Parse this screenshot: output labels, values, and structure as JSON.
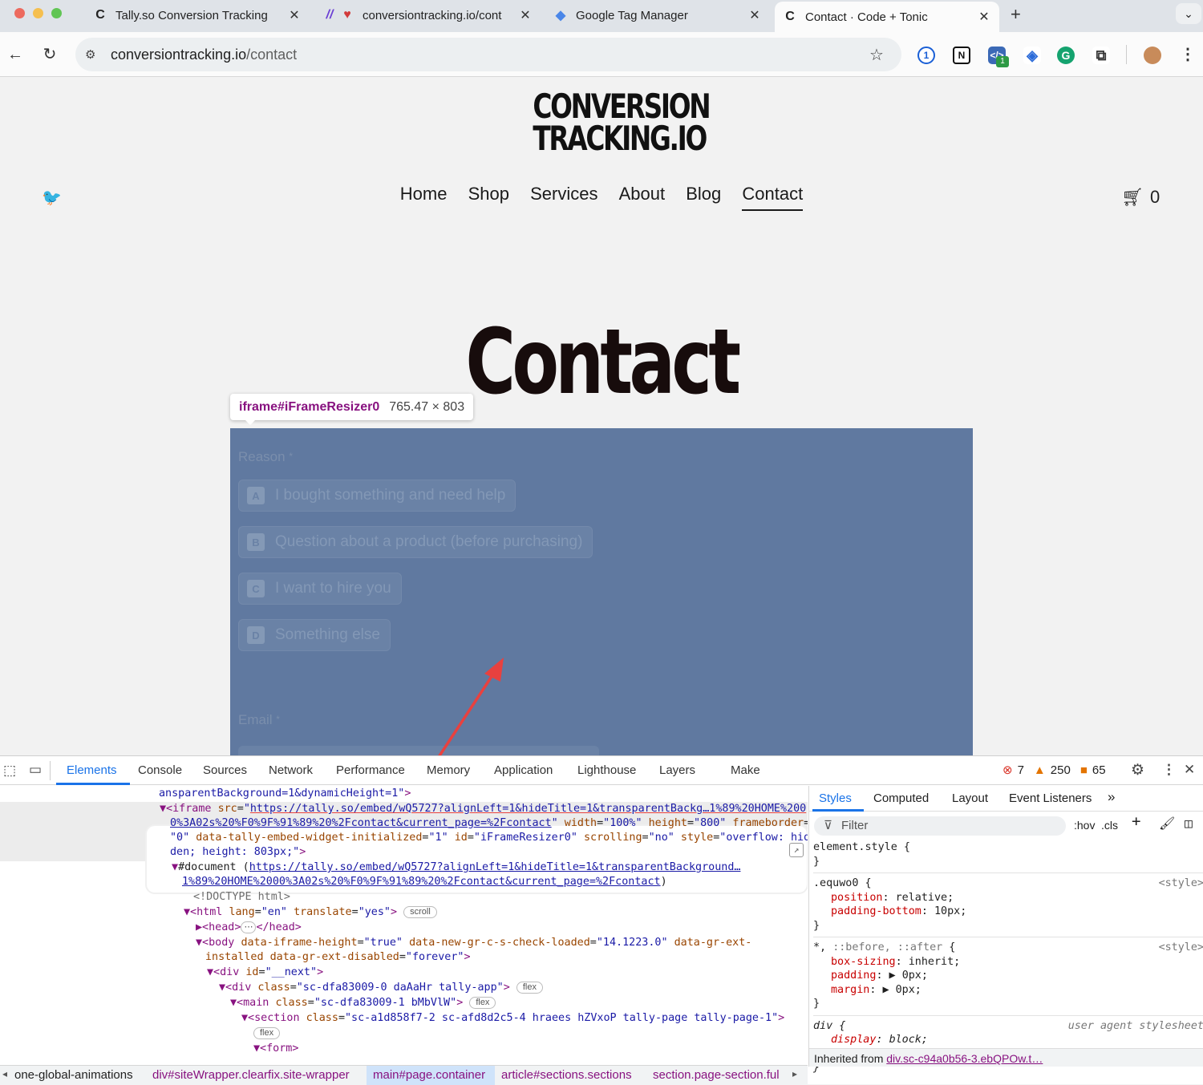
{
  "browser": {
    "tabs": [
      {
        "title": "Tally.so Conversion Tracking",
        "icon": "C"
      },
      {
        "title": "conversiontracking.io/cont",
        "icon": "M"
      },
      {
        "title": "Google Tag Manager",
        "icon": "gtm"
      },
      {
        "title": "Contact · Code + Tonic",
        "icon": "C"
      }
    ],
    "url_host": "conversiontracking.io",
    "url_path": "/contact",
    "ext_badge": "1"
  },
  "site": {
    "logo_line1": "CONVERSION",
    "logo_line2": "TRACKING.IO",
    "nav": [
      "Home",
      "Shop",
      "Services",
      "About",
      "Blog",
      "Contact"
    ],
    "cart_count": "0",
    "heading": "Contact"
  },
  "inspect_tooltip": {
    "selector": "iframe#iFrameResizer0",
    "size": "765.47 × 803"
  },
  "form": {
    "reason_label": "Reason",
    "options": [
      {
        "key": "A",
        "text": "I bought something and need help"
      },
      {
        "key": "B",
        "text": "Question about a product (before purchasing)"
      },
      {
        "key": "C",
        "text": "I want to hire you"
      },
      {
        "key": "D",
        "text": "Something else"
      }
    ],
    "email_label": "Email",
    "required_mark": "*"
  },
  "devtools": {
    "tabs": [
      "Elements",
      "Console",
      "Sources",
      "Network",
      "Performance",
      "Memory",
      "Application",
      "Lighthouse",
      "Layers",
      "Make"
    ],
    "errors": "7",
    "warnings": "250",
    "issues": "65",
    "side_tabs": [
      "Styles",
      "Computed",
      "Layout",
      "Event Listeners"
    ],
    "filter_placeholder": "Filter",
    "hov": ":hov",
    "cls": ".cls",
    "breadcrumbs": [
      "one-global-animations",
      "div#siteWrapper.clearfix.site-wrapper",
      "main#page.container",
      "article#sections.sections",
      "section.page-section.ful"
    ],
    "inherited": "Inherited from",
    "inherited_sel": "div.sc-c94a0b56-3.ebQPOw.t…"
  }
}
